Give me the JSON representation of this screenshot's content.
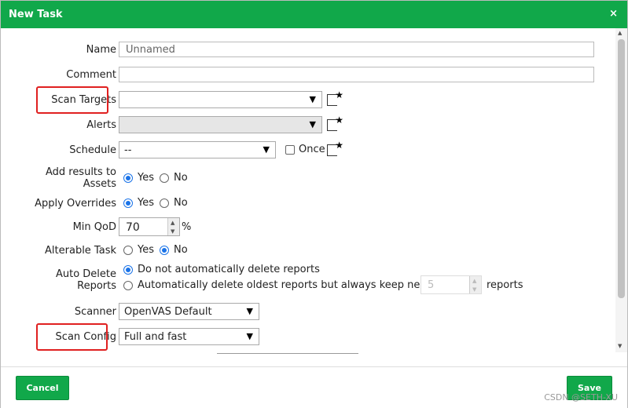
{
  "dialog": {
    "title": "New Task",
    "close_symbol": "×"
  },
  "form": {
    "name": {
      "label": "Name",
      "value": "Unnamed"
    },
    "comment": {
      "label": "Comment",
      "value": ""
    },
    "scan_targets": {
      "label": "Scan Targets",
      "selected": ""
    },
    "alerts": {
      "label": "Alerts",
      "selected": ""
    },
    "schedule": {
      "label": "Schedule",
      "selected": "--",
      "once_label": "Once"
    },
    "add_results": {
      "label_line1": "Add results to",
      "label_line2": "Assets",
      "yes": "Yes",
      "no": "No",
      "value": "Yes"
    },
    "apply_overrides": {
      "label": "Apply Overrides",
      "yes": "Yes",
      "no": "No",
      "value": "Yes"
    },
    "min_qod": {
      "label": "Min QoD",
      "value": "70",
      "unit": "%"
    },
    "alterable": {
      "label": "Alterable Task",
      "yes": "Yes",
      "no": "No",
      "value": "No"
    },
    "auto_delete": {
      "label_line1": "Auto Delete",
      "label_line2": "Reports",
      "option1": "Do not automatically delete reports",
      "option2": "Automatically delete oldest reports but always keep newest",
      "keep_value": "5",
      "suffix": "reports"
    },
    "scanner": {
      "label": "Scanner",
      "selected": "OpenVAS Default"
    },
    "scan_config": {
      "label": "Scan Config",
      "selected": "Full and fast"
    }
  },
  "footer": {
    "cancel_label": "Cancel",
    "save_label": "Save"
  },
  "watermark": "CSDN @SETH-XU",
  "colors": {
    "brand": "#11a84a",
    "highlight": "#e02020",
    "radio_on": "#1a73e8"
  }
}
